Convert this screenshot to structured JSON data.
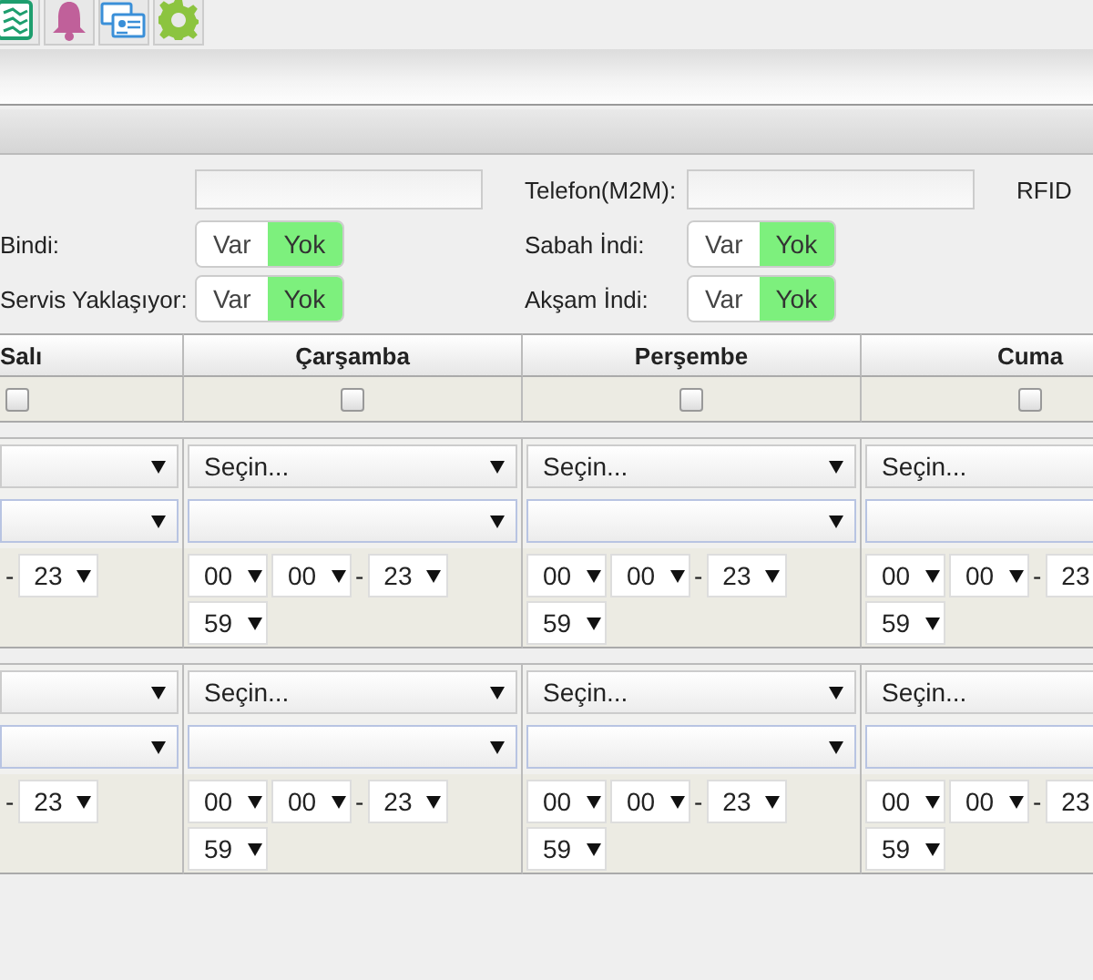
{
  "form_rows": [
    [
      {
        "kind": "input"
      },
      {
        "kind": "input",
        "label": "Telefon(M2M):"
      },
      {
        "kind": "text",
        "label": "RFID"
      }
    ],
    [
      {
        "kind": "toggle",
        "label": "Bindi:",
        "options": [
          {
            "label": "Var",
            "selected": false
          },
          {
            "label": "Yok",
            "selected": true
          }
        ]
      },
      {
        "kind": "toggle",
        "label": "Sabah İndi:",
        "options": [
          {
            "label": "Var",
            "selected": false
          },
          {
            "label": "Yok",
            "selected": true
          }
        ]
      }
    ],
    [
      {
        "kind": "toggle",
        "label": "Servis Yaklaşıyor:",
        "options": [
          {
            "label": "Var",
            "selected": false
          },
          {
            "label": "Yok",
            "selected": true
          }
        ]
      },
      {
        "kind": "toggle",
        "label": "Akşam İndi:",
        "options": [
          {
            "label": "Var",
            "selected": false
          },
          {
            "label": "Yok",
            "selected": true
          }
        ]
      }
    ]
  ],
  "days": [
    {
      "name": "Salı",
      "checked": false
    },
    {
      "name": "Çarşamba",
      "checked": false
    },
    {
      "name": "Perşembe",
      "checked": false
    },
    {
      "name": "Cuma",
      "checked": false
    }
  ],
  "schedule": [
    {
      "cells": [
        {
          "times": [
            {
              "kind": "dash",
              "value": "-"
            },
            {
              "kind": "select",
              "value": "23"
            }
          ]
        },
        {
          "choice": "Seçin...",
          "times": [
            {
              "kind": "select",
              "value": "00"
            },
            {
              "kind": "select",
              "value": "00"
            },
            {
              "kind": "dash",
              "value": "-"
            },
            {
              "kind": "select",
              "value": "23"
            },
            {
              "kind": "select",
              "value": "59"
            }
          ]
        },
        {
          "choice": "Seçin...",
          "times": [
            {
              "kind": "select",
              "value": "00"
            },
            {
              "kind": "select",
              "value": "00"
            },
            {
              "kind": "dash",
              "value": "-"
            },
            {
              "kind": "select",
              "value": "23"
            },
            {
              "kind": "select",
              "value": "59"
            }
          ]
        },
        {
          "choice": "Seçin...",
          "times": [
            {
              "kind": "select",
              "value": "00"
            },
            {
              "kind": "select",
              "value": "00"
            },
            {
              "kind": "dash",
              "value": "-"
            },
            {
              "kind": "select",
              "value": "23"
            },
            {
              "kind": "select",
              "value": "59"
            }
          ]
        }
      ]
    },
    {
      "cells": [
        {
          "times": [
            {
              "kind": "dash",
              "value": "-"
            },
            {
              "kind": "select",
              "value": "23"
            }
          ]
        },
        {
          "choice": "Seçin...",
          "times": [
            {
              "kind": "select",
              "value": "00"
            },
            {
              "kind": "select",
              "value": "00"
            },
            {
              "kind": "dash",
              "value": "-"
            },
            {
              "kind": "select",
              "value": "23"
            },
            {
              "kind": "select",
              "value": "59"
            }
          ]
        },
        {
          "choice": "Seçin...",
          "times": [
            {
              "kind": "select",
              "value": "00"
            },
            {
              "kind": "select",
              "value": "00"
            },
            {
              "kind": "dash",
              "value": "-"
            },
            {
              "kind": "select",
              "value": "23"
            },
            {
              "kind": "select",
              "value": "59"
            }
          ]
        },
        {
          "choice": "Seçin...",
          "times": [
            {
              "kind": "select",
              "value": "00"
            },
            {
              "kind": "select",
              "value": "00"
            },
            {
              "kind": "dash",
              "value": "-"
            },
            {
              "kind": "select",
              "value": "23"
            },
            {
              "kind": "select",
              "value": "59"
            }
          ]
        }
      ]
    }
  ]
}
